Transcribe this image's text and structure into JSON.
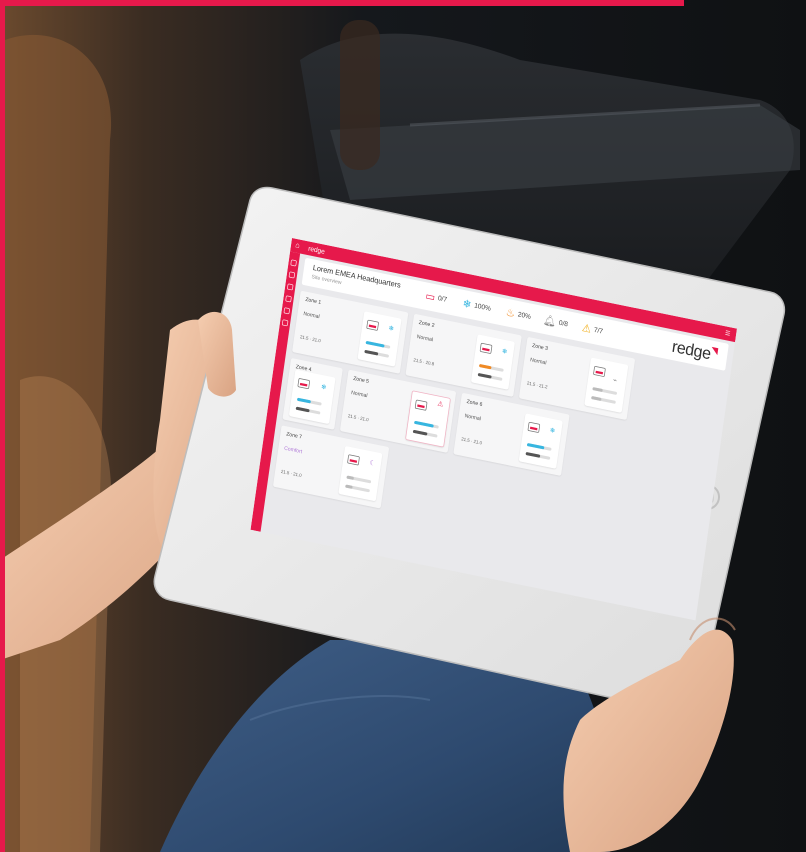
{
  "scene": {
    "description": "Hands holding a white tablet displaying a building climate-control dashboard",
    "colors": {
      "accent": "#e6194b",
      "snow": "#37b6e0",
      "heat": "#f08a24",
      "purple": "#b07ad8"
    }
  },
  "app": {
    "brand": "redge",
    "header": {
      "title": "Lorem EMEA Headquarters",
      "subtitle": "Site overview"
    },
    "stats": [
      {
        "icon": "device-icon",
        "value": "0/7"
      },
      {
        "icon": "snowflake-icon",
        "value": "100%"
      },
      {
        "icon": "flame-icon",
        "value": "20%"
      },
      {
        "icon": "bell-icon",
        "value": "0/8"
      },
      {
        "icon": "warning-icon",
        "value": "7/7"
      }
    ],
    "zones": [
      {
        "name": "Zone 1",
        "mode": "Normal",
        "meta": "21.5 · 21.0",
        "fill": 0.75,
        "color": "#37b6e0"
      },
      {
        "name": "Zone 2",
        "mode": "Normal",
        "meta": "21.5 · 20.8",
        "fill": 0.5,
        "color": "#f08a24"
      },
      {
        "name": "Zone 3",
        "mode": "Normal",
        "meta": "21.5 · 21.2",
        "fill": 0.4,
        "color": "#bbbbbb"
      },
      {
        "name": "Zone 4",
        "mode": "",
        "meta": "",
        "fill": 0.55,
        "color": "#37b6e0"
      },
      {
        "name": "Zone 5",
        "mode": "Normal",
        "meta": "21.5 · 21.0",
        "fill": 0.8,
        "color": "#37b6e0"
      },
      {
        "name": "Zone 6",
        "mode": "Normal",
        "meta": "21.5 · 21.0",
        "fill": 0.7,
        "color": "#37b6e0"
      },
      {
        "name": "Zone 7",
        "mode": "Comfort",
        "meta": "21.5 · 21.0",
        "fill": 0.3,
        "color": "#bbbbbb"
      }
    ]
  }
}
